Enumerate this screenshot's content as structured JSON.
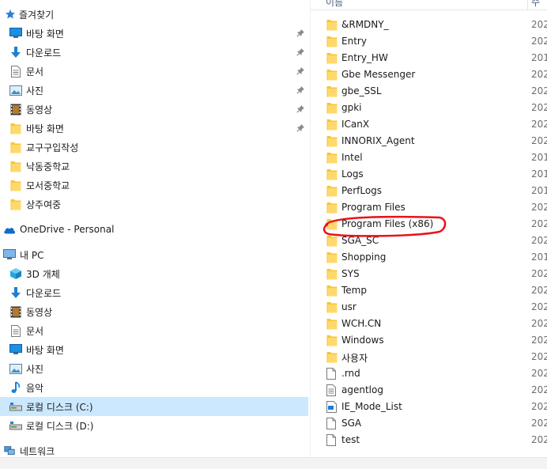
{
  "nav": {
    "quick_access": {
      "label": "즐겨찾기",
      "icon": "star-icon"
    },
    "quick_items": [
      {
        "label": "바탕 화면",
        "icon": "desktop-icon",
        "pinned": true
      },
      {
        "label": "다운로드",
        "icon": "download-arrow-icon",
        "pinned": true
      },
      {
        "label": "문서",
        "icon": "document-icon",
        "pinned": true
      },
      {
        "label": "사진",
        "icon": "pictures-icon",
        "pinned": true
      },
      {
        "label": "동영상",
        "icon": "video-icon",
        "pinned": true
      },
      {
        "label": "바탕 화면",
        "icon": "folder-icon",
        "pinned": true
      },
      {
        "label": "교구구입작성",
        "icon": "folder-icon",
        "pinned": false
      },
      {
        "label": "낙동중학교",
        "icon": "folder-icon",
        "pinned": false
      },
      {
        "label": "모서중학교",
        "icon": "folder-icon",
        "pinned": false
      },
      {
        "label": "상주여중",
        "icon": "folder-icon",
        "pinned": false
      }
    ],
    "onedrive": {
      "label": "OneDrive - Personal",
      "icon": "cloud-icon"
    },
    "this_pc": {
      "label": "내 PC",
      "icon": "computer-icon"
    },
    "pc_items": [
      {
        "label": "3D 개체",
        "icon": "cube-3d-icon"
      },
      {
        "label": "다운로드",
        "icon": "download-arrow-icon"
      },
      {
        "label": "동영상",
        "icon": "video-icon"
      },
      {
        "label": "문서",
        "icon": "document-icon"
      },
      {
        "label": "바탕 화면",
        "icon": "desktop-icon"
      },
      {
        "label": "사진",
        "icon": "pictures-icon"
      },
      {
        "label": "음악",
        "icon": "music-icon"
      },
      {
        "label": "로컬 디스크 (C:)",
        "icon": "drive-icon",
        "selected": true
      },
      {
        "label": "로컬 디스크 (D:)",
        "icon": "drive-icon"
      }
    ],
    "network": {
      "label": "네트워크",
      "icon": "network-icon"
    }
  },
  "columns": {
    "name": "이름",
    "modified": "수정"
  },
  "files": [
    {
      "name": "&RMDNY_",
      "type": "folder",
      "date": "202"
    },
    {
      "name": "Entry",
      "type": "folder",
      "date": "202"
    },
    {
      "name": "Entry_HW",
      "type": "folder",
      "date": "201"
    },
    {
      "name": "Gbe Messenger",
      "type": "folder",
      "date": "202"
    },
    {
      "name": "gbe_SSL",
      "type": "folder",
      "date": "202"
    },
    {
      "name": "gpki",
      "type": "folder",
      "date": "202"
    },
    {
      "name": "ICanX",
      "type": "folder",
      "date": "202"
    },
    {
      "name": "INNORIX_Agent",
      "type": "folder",
      "date": "202"
    },
    {
      "name": "Intel",
      "type": "folder",
      "date": "201"
    },
    {
      "name": "Logs",
      "type": "folder",
      "date": "201"
    },
    {
      "name": "PerfLogs",
      "type": "folder",
      "date": "201"
    },
    {
      "name": "Program Files",
      "type": "folder",
      "date": "202"
    },
    {
      "name": "Program Files (x86)",
      "type": "folder",
      "date": "202",
      "highlighted": true
    },
    {
      "name": "SGA_SC",
      "type": "folder",
      "date": "202"
    },
    {
      "name": "Shopping",
      "type": "folder",
      "date": "201"
    },
    {
      "name": "SYS",
      "type": "folder",
      "date": "202"
    },
    {
      "name": "Temp",
      "type": "folder",
      "date": "202"
    },
    {
      "name": "usr",
      "type": "folder",
      "date": "202"
    },
    {
      "name": "WCH.CN",
      "type": "folder",
      "date": "202"
    },
    {
      "name": "Windows",
      "type": "folder",
      "date": "202"
    },
    {
      "name": "사용자",
      "type": "folder",
      "date": "202"
    },
    {
      "name": ".rnd",
      "type": "file",
      "date": "202"
    },
    {
      "name": "agentlog",
      "type": "textfile",
      "date": "202"
    },
    {
      "name": "IE_Mode_List",
      "type": "xmlfile",
      "date": "202"
    },
    {
      "name": "SGA",
      "type": "file",
      "date": "202"
    },
    {
      "name": "test",
      "type": "file",
      "date": "202"
    }
  ],
  "colors": {
    "selection": "#cce8ff",
    "folder": "#ffd96b",
    "annotation": "#e8131b"
  }
}
